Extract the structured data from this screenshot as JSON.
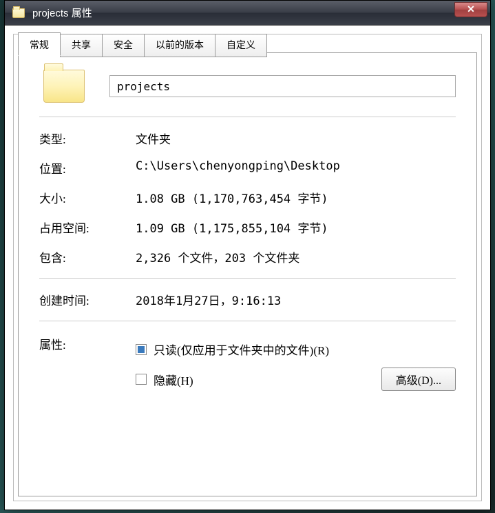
{
  "window": {
    "title": "projects 属性"
  },
  "tabs": {
    "general": "常规",
    "sharing": "共享",
    "security": "安全",
    "previous_versions": "以前的版本",
    "customize": "自定义"
  },
  "general": {
    "name": "projects",
    "type_label": "类型:",
    "type_value": "文件夹",
    "location_label": "位置:",
    "location_value": "C:\\Users\\chenyongping\\Desktop",
    "size_label": "大小:",
    "size_value": "1.08 GB (1,170,763,454 字节)",
    "size_on_disk_label": "占用空间:",
    "size_on_disk_value": "1.09 GB (1,175,855,104 字节)",
    "contains_label": "包含:",
    "contains_value": "2,326 个文件，203 个文件夹",
    "created_label": "创建时间:",
    "created_value": "2018年1月27日，9:16:13",
    "attributes_label": "属性:",
    "readonly_label": "只读(仅应用于文件夹中的文件)(R)",
    "hidden_label": "隐藏(H)",
    "advanced_button": "高级(D)..."
  }
}
